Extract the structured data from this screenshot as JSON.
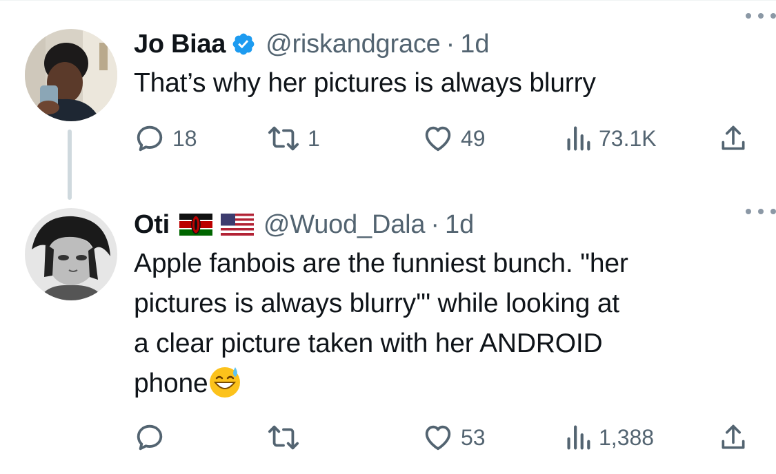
{
  "tweets": [
    {
      "name": "Jo Biaa",
      "handle": "@riskandgrace",
      "separator": "·",
      "time": "1d",
      "verified": true,
      "text": "That’s why her pictures is always blurry",
      "replies": "18",
      "retweets": "1",
      "likes": "49",
      "views": "73.1K"
    },
    {
      "name": "Oti",
      "handle": "@Wuod_Dala",
      "separator": "·",
      "time": "1d",
      "flags": [
        "kenya-flag",
        "usa-flag"
      ],
      "text": "Apple fanbois are the funniest bunch. \"her\npictures is always blurry'\" while looking at\na clear picture taken with her ANDROID\nphone",
      "text_emoji": "grinning-face-with-sweat-icon",
      "replies": "",
      "retweets": "",
      "likes": "53",
      "views": "1,388"
    }
  ],
  "colors": {
    "text": "#0f1419",
    "secondary": "#536471",
    "verified": "#1d9bf0",
    "divider": "#eff3f4",
    "thread_line": "#cfd9de"
  },
  "icons": {
    "reply": "reply-icon",
    "retweet": "retweet-icon",
    "like": "heart-icon",
    "views": "views-bar-chart-icon",
    "share": "share-icon",
    "more": "more-options-icon",
    "verified": "verified-badge-icon"
  }
}
